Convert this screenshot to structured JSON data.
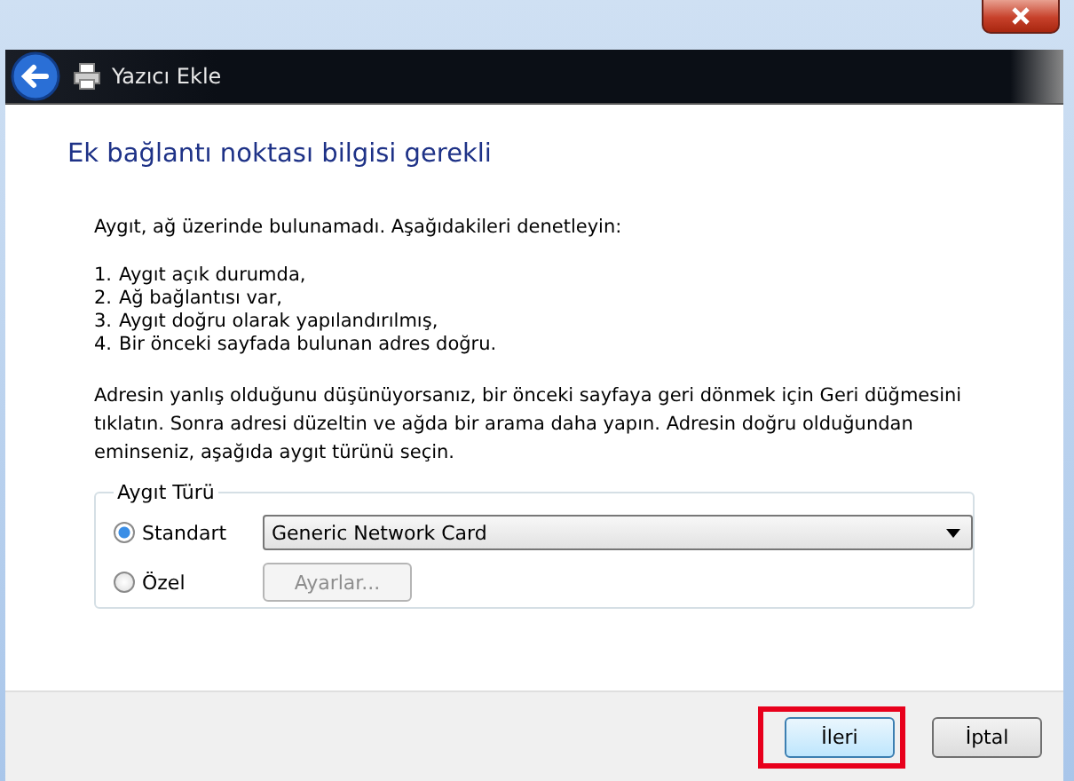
{
  "window": {
    "title": "Yazıcı Ekle"
  },
  "heading": "Ek bağlantı noktası bilgisi gerekli",
  "intro": "Aygıt, ağ üzerinde bulunamadı.  Aşağıdakileri denetleyin:",
  "checklist": [
    "Aygıt açık durumda,",
    "Ağ bağlantısı var,",
    "Aygıt doğru olarak yapılandırılmış,",
    "Bir önceki sayfada bulunan adres doğru."
  ],
  "checklist_numbers": [
    "1.",
    "2.",
    "3.",
    "4."
  ],
  "advice": "Adresin yanlış olduğunu düşünüyorsanız, bir önceki sayfaya geri dönmek için Geri düğmesini tıklatın. Sonra adresi düzeltin ve ağda bir arama daha yapın. Adresin doğru olduğundan eminseniz, aşağıda aygıt türünü seçin.",
  "device_type": {
    "title": "Aygıt Türü",
    "options": [
      {
        "label": "Standart",
        "selected": true,
        "kind": "dropdown",
        "value": "Generic Network Card"
      },
      {
        "label": "Özel",
        "selected": false,
        "kind": "button",
        "button": "Ayarlar...",
        "disabled": true
      }
    ]
  },
  "buttons": [
    {
      "label": "İleri",
      "highlighted": true
    },
    {
      "label": "İptal",
      "highlighted": false
    }
  ]
}
